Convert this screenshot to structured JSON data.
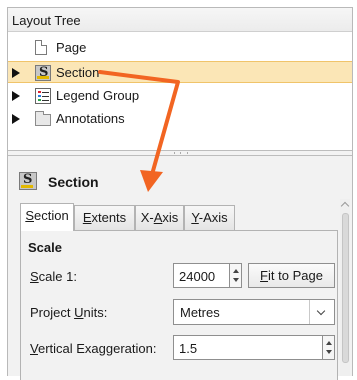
{
  "tree": {
    "header": "Layout Tree",
    "items": [
      {
        "label": "Page"
      },
      {
        "label": "Section"
      },
      {
        "label": "Legend Group"
      },
      {
        "label": "Annotations"
      }
    ]
  },
  "properties": {
    "title": "Section",
    "tabs": [
      {
        "pre": "",
        "key": "S",
        "post": "ection"
      },
      {
        "pre": "",
        "key": "E",
        "post": "xtents"
      },
      {
        "pre": "X-",
        "key": "A",
        "post": "xis"
      },
      {
        "pre": "",
        "key": "Y",
        "post": "-Axis"
      }
    ],
    "section_heading": "Scale",
    "scale": {
      "pre": "",
      "key": "S",
      "post": "cale 1:",
      "value": "24000"
    },
    "fit_button": {
      "pre": "",
      "key": "F",
      "post": "it to Page"
    },
    "units": {
      "pre": "Project ",
      "key": "U",
      "post": "nits:",
      "value": "Metres"
    },
    "exaggeration": {
      "pre": "",
      "key": "V",
      "post": "ertical Exaggeration:",
      "value": "1.5"
    }
  },
  "colors": {
    "selection": "#fbe6b6",
    "annotation_arrow": "#f26522"
  }
}
